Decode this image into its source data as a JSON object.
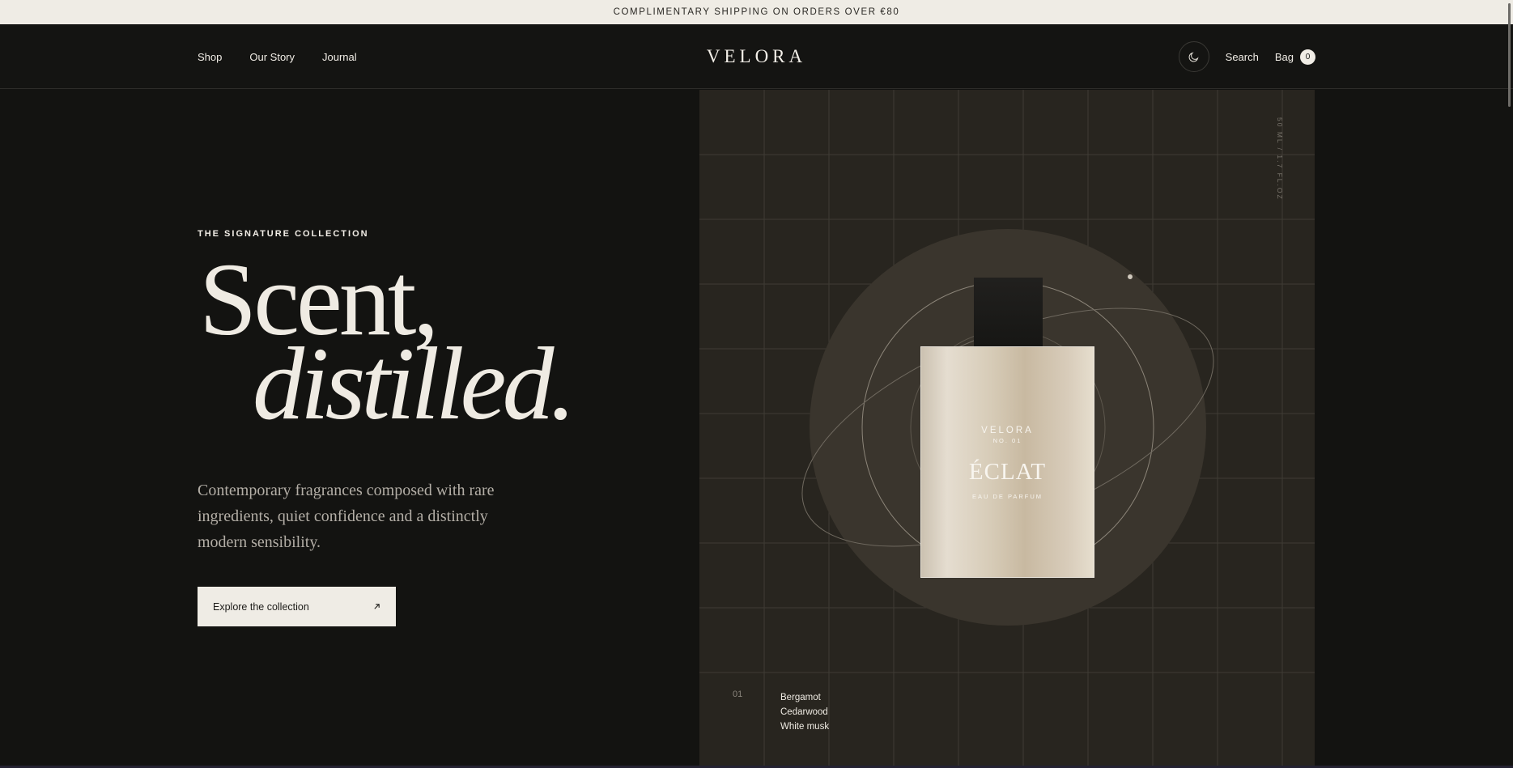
{
  "announcement": "COMPLIMENTARY SHIPPING ON ORDERS OVER €80",
  "header": {
    "nav": [
      "Shop",
      "Our Story",
      "Journal"
    ],
    "logo": "VELORA",
    "search_label": "Search",
    "bag_label": "Bag",
    "bag_count": "0",
    "theme_icon": "moon-icon"
  },
  "hero": {
    "eyebrow": "THE SIGNATURE COLLECTION",
    "title_line1": "Scent,",
    "title_line2": "distilled.",
    "lede": "Contemporary fragrances composed with rare ingredients, quiet confidence and a distinctly modern sensibility.",
    "cta_label": "Explore the collection",
    "cta_icon": "arrow-up-right-icon"
  },
  "product": {
    "volume": "50 ML / 1.7 FL.OZ",
    "brand": "VELORA",
    "number": "NO. 01",
    "name": "ÉCLAT",
    "type": "EAU DE PARFUM",
    "index": "01",
    "notes": [
      "Bergamot",
      "Cedarwood",
      "White musk"
    ]
  },
  "colors": {
    "background": "#131311",
    "panel": "#28251f",
    "accent_light": "#efece5"
  }
}
